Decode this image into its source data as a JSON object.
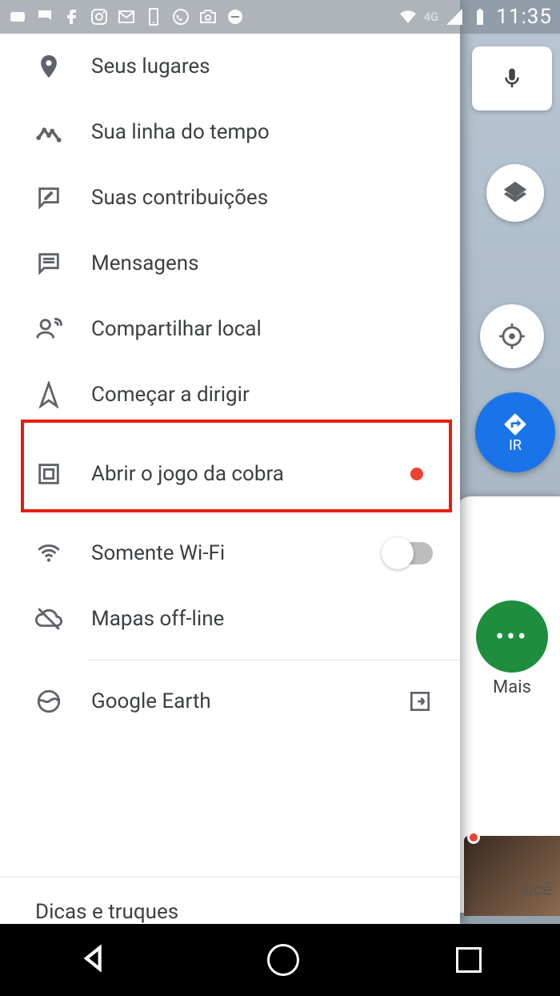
{
  "status": {
    "time": "11:35",
    "network": "4G"
  },
  "bg": {
    "go_label": "IR",
    "mais_label": "Mais",
    "voce_label": "ocê"
  },
  "menu": {
    "items": [
      {
        "label": "Seus lugares"
      },
      {
        "label": "Sua linha do tempo"
      },
      {
        "label": "Suas contribuições"
      },
      {
        "label": "Mensagens"
      },
      {
        "label": "Compartilhar local"
      },
      {
        "label": "Começar a dirigir"
      },
      {
        "label": "Abrir o jogo da cobra"
      },
      {
        "label": "Somente Wi-Fi"
      },
      {
        "label": "Mapas off-line"
      },
      {
        "label": "Google Earth"
      }
    ],
    "footer": "Dicas e truques"
  }
}
